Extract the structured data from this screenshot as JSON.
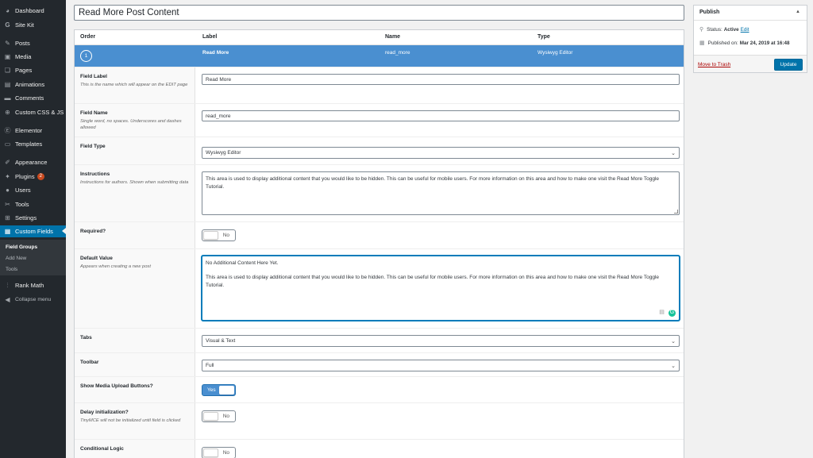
{
  "sidebar": {
    "items": [
      {
        "label": "Dashboard",
        "icon": "dashboard-icon"
      },
      {
        "label": "Site Kit",
        "icon": "google-icon"
      },
      {
        "label": "Posts",
        "icon": "pushpin-icon"
      },
      {
        "label": "Media",
        "icon": "media-icon"
      },
      {
        "label": "Pages",
        "icon": "pages-icon"
      },
      {
        "label": "Animations",
        "icon": "film-icon"
      },
      {
        "label": "Comments",
        "icon": "comment-icon"
      },
      {
        "label": "Custom CSS & JS",
        "icon": "plus-circle-icon"
      },
      {
        "label": "Elementor",
        "icon": "elementor-icon"
      },
      {
        "label": "Templates",
        "icon": "folder-icon"
      },
      {
        "label": "Appearance",
        "icon": "brush-icon"
      },
      {
        "label": "Plugins",
        "icon": "plug-icon",
        "badge": "2"
      },
      {
        "label": "Users",
        "icon": "user-icon"
      },
      {
        "label": "Tools",
        "icon": "wrench-icon"
      },
      {
        "label": "Settings",
        "icon": "settings-icon"
      },
      {
        "label": "Custom Fields",
        "icon": "table-icon"
      },
      {
        "label": "Rank Math",
        "icon": "chart-icon"
      },
      {
        "label": "Collapse menu",
        "icon": "collapse-icon"
      }
    ],
    "submenu": [
      "Field Groups",
      "Add New",
      "Tools"
    ]
  },
  "title": "Read More Post Content",
  "table": {
    "headers": [
      "Order",
      "Label",
      "Name",
      "Type"
    ],
    "active_row": {
      "order": "1",
      "label": "Read More",
      "name": "read_more",
      "type": "Wysiwyg Editor"
    }
  },
  "fields": {
    "field_label": {
      "label": "Field Label",
      "desc": "This is the name which will appear on the EDIT page",
      "value": "Read More"
    },
    "field_name": {
      "label": "Field Name",
      "desc": "Single word, no spaces. Underscores and dashes allowed",
      "value": "read_more"
    },
    "field_type": {
      "label": "Field Type",
      "value": "Wysiwyg Editor"
    },
    "instructions": {
      "label": "Instructions",
      "desc": "Instructions for authors. Shown when submitting data",
      "value": "This area is used to display additional content that you would like to be hidden. This can be useful for mobile users. For more information on this area and how to make one visit the Read More Toggle Tutorial."
    },
    "required": {
      "label": "Required?",
      "value": "No"
    },
    "default_value": {
      "label": "Default Value",
      "desc": "Appears when creating a new post",
      "line1": "No Additional Content Here Yet.",
      "line2": "This area is used to display additional content that you would like to be hidden. This can be useful for mobile users. For more information on this area and how to make one visit the Read More Toggle Tutorial."
    },
    "tabs": {
      "label": "Tabs",
      "value": "Visual & Text"
    },
    "toolbar": {
      "label": "Toolbar",
      "value": "Full"
    },
    "media_upload": {
      "label": "Show Media Upload Buttons?",
      "value": "Yes"
    },
    "delay_init": {
      "label": "Delay initialization?",
      "desc": "TinyMCE will not be initialized until field is clicked",
      "value": "No"
    },
    "conditional_logic": {
      "label": "Conditional Logic",
      "value": "No"
    }
  },
  "publish": {
    "title": "Publish",
    "status_label": "Status:",
    "status_value": "Active",
    "edit_link": "Edit",
    "published_label": "Published on:",
    "published_value": "Mar 24, 2019 at 16:48",
    "trash": "Move to Trash",
    "update": "Update"
  },
  "colors": {
    "accent": "#0073aa",
    "row_highlight": "#4a8fd0",
    "sidebar": "#23282d",
    "badge": "#ca4a1f"
  }
}
